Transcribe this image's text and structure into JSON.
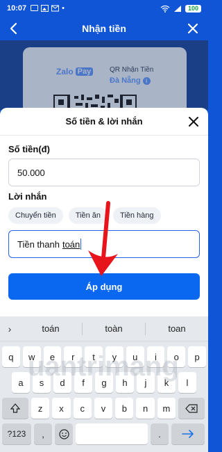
{
  "status_bar": {
    "time": "10:07",
    "battery": "100"
  },
  "header": {
    "title": "Nhận tiền"
  },
  "qr_card": {
    "logo_main": "Zalo",
    "logo_pay": "Pay",
    "title": "QR Nhận Tiền",
    "location": "Đà Nẵng"
  },
  "sheet": {
    "title": "Số tiền & lời nhắn",
    "amount_label": "Số tiền(đ)",
    "amount_value": "50.000",
    "message_label": "Lời nhắn",
    "chips": [
      "Chuyển tiền",
      "Tiền ăn",
      "Tiền hàng"
    ],
    "message_text": "Tiền thanh",
    "message_underlined": "toán",
    "apply_label": "Áp dụng"
  },
  "keyboard": {
    "suggestions": [
      "toán",
      "toàn",
      "toan"
    ],
    "row1": [
      "q",
      "w",
      "e",
      "r",
      "t",
      "y",
      "u",
      "i",
      "o",
      "p"
    ],
    "row2": [
      "a",
      "s",
      "d",
      "f",
      "g",
      "h",
      "j",
      "k",
      "l"
    ],
    "row3": [
      "z",
      "x",
      "c",
      "v",
      "b",
      "n",
      "m"
    ],
    "symbols_key": "?123",
    "comma_key": ",",
    "period_key": ".",
    "watermark": "uantrimang"
  },
  "colors": {
    "primary": "#0a68f0",
    "header": "#0f55d6",
    "annotation": "#e8141b"
  }
}
